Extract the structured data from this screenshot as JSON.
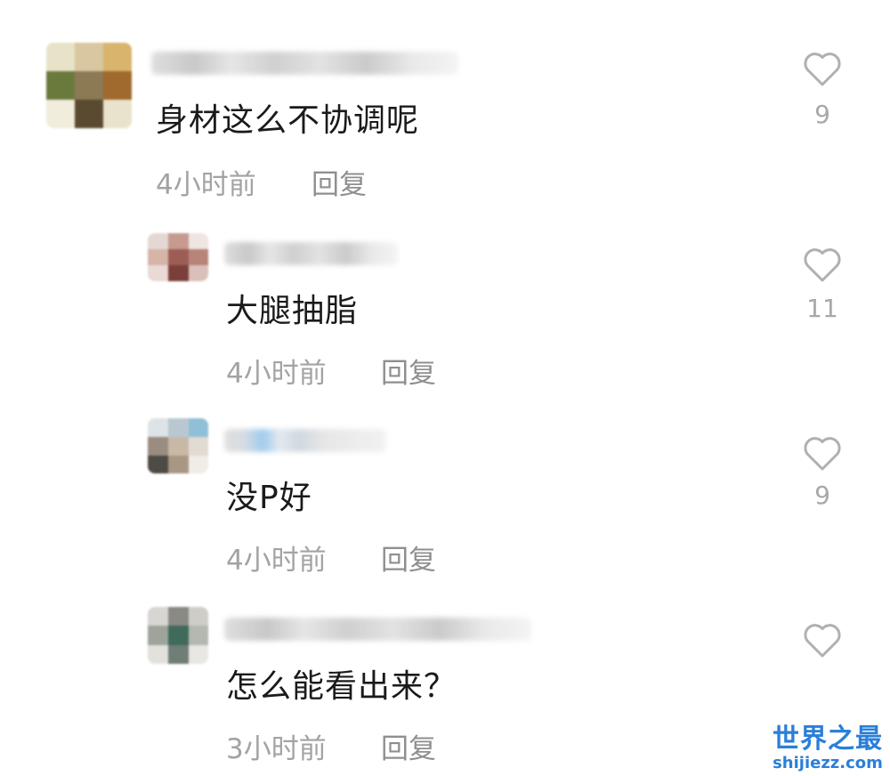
{
  "comments": [
    {
      "text": "身材这么不协调呢",
      "time": "4小时前",
      "reply_label": "回复",
      "likes": "9"
    },
    {
      "text": "大腿抽脂",
      "time": "4小时前",
      "reply_label": "回复",
      "likes": "11"
    },
    {
      "text": "没P好",
      "time": "4小时前",
      "reply_label": "回复",
      "likes": "9"
    },
    {
      "text": "怎么能看出来？",
      "time": "3小时前",
      "reply_label": "回复",
      "likes": ""
    }
  ],
  "watermark": {
    "title": "世界之最",
    "site": "shijiezz.com"
  },
  "colors": {
    "accent": "#2a7fd9",
    "meta": "#a3a3a3",
    "heart": "#b0b0b0"
  },
  "icons": {
    "like": "heart-outline-icon"
  }
}
